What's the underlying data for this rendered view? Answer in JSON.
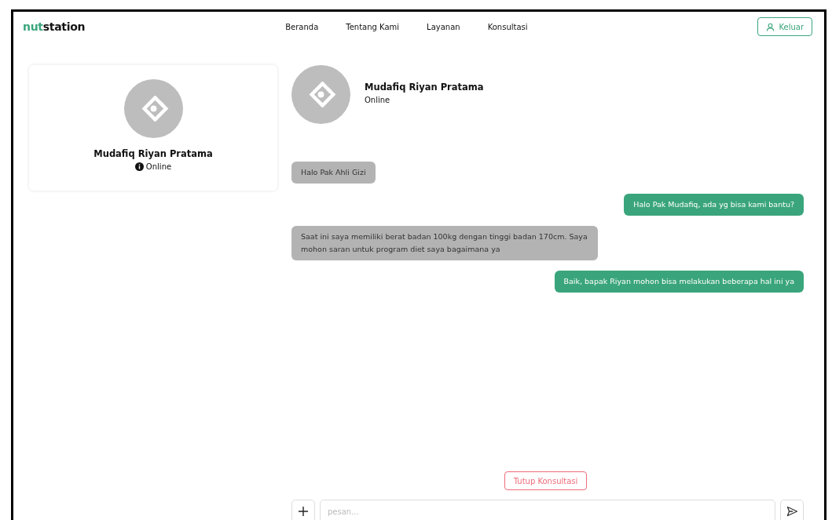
{
  "logo": {
    "accent": "nut",
    "rest": "station"
  },
  "nav": [
    {
      "label": "Beranda"
    },
    {
      "label": "Tentang Kami"
    },
    {
      "label": "Layanan"
    },
    {
      "label": "Konsultasi"
    }
  ],
  "logout_button": "Keluar",
  "profile_card": {
    "name": "Mudafiq Riyan Pratama",
    "status": "Online"
  },
  "chat_header": {
    "name": "Mudafiq Riyan Pratama",
    "status": "Online"
  },
  "messages": [
    {
      "kind": "received",
      "text": "Halo Pak Ahli Gizi"
    },
    {
      "kind": "sent",
      "text": "Halo Pak Mudafiq, ada yg bisa kami bantu?"
    },
    {
      "kind": "received",
      "text": "Saat ini saya memiliki berat badan 100kg dengan tinggi badan 170cm. Saya mohon saran untuk program diet saya bagaimana ya"
    },
    {
      "kind": "sent",
      "text": "Baik, bapak Riyan mohon bisa melakukan beberapa hal ini ya"
    }
  ],
  "close_button": "Tutup Konsultasi",
  "message_input": {
    "placeholder": "pesan..."
  }
}
